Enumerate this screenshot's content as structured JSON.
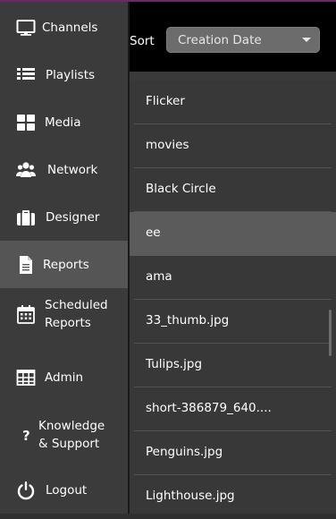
{
  "sidebar": {
    "items": [
      {
        "label": "Channels",
        "icon": "monitor-icon"
      },
      {
        "label": "Playlists",
        "icon": "list-icon"
      },
      {
        "label": "Media",
        "icon": "grid-icon"
      },
      {
        "label": "Network",
        "icon": "users-icon"
      },
      {
        "label": "Designer",
        "icon": "briefcase-icon"
      },
      {
        "label": "Reports",
        "icon": "document-icon",
        "active": true
      },
      {
        "label": "Scheduled\nReports",
        "icon": "calendar-icon"
      },
      {
        "label": "Admin",
        "icon": "table-icon"
      },
      {
        "label": "Knowledge\n& Support",
        "icon": "question-icon"
      },
      {
        "label": "Logout",
        "icon": "power-icon"
      }
    ]
  },
  "header": {
    "sort_label": "Sort",
    "sort_value": "Creation Date"
  },
  "list": {
    "items": [
      {
        "name": "Flicker"
      },
      {
        "name": "movies"
      },
      {
        "name": "Black Circle"
      },
      {
        "name": "ee",
        "selected": true
      },
      {
        "name": "ama"
      },
      {
        "name": "33_thumb.jpg"
      },
      {
        "name": "Tulips.jpg"
      },
      {
        "name": "short-386879_640...."
      },
      {
        "name": "Penguins.jpg"
      },
      {
        "name": "Lighthouse.jpg"
      }
    ]
  },
  "colors": {
    "sidebar_bg": "#3b3b3b",
    "active_bg": "#555555",
    "header_bg": "#000000",
    "list_bg": "#383838",
    "selected_bg": "#5b5b5b"
  }
}
